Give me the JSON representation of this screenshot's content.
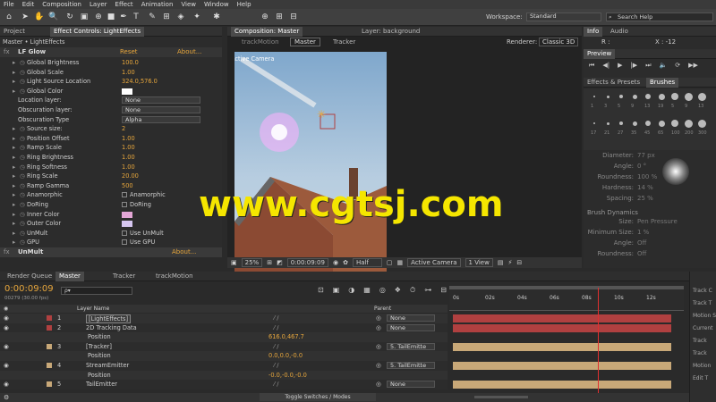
{
  "menu": [
    "File",
    "Edit",
    "Composition",
    "Layer",
    "Effect",
    "Animation",
    "View",
    "Window",
    "Help"
  ],
  "workspace": {
    "label": "Workspace:",
    "value": "Standard",
    "search_placeholder": "Search Help"
  },
  "left_tabs": [
    "Project",
    "Effect Controls: LightEffects"
  ],
  "effect_controls": {
    "breadcrumb": "Master • LightEffects",
    "effect_name": "LF Glow",
    "reset": "Reset",
    "about": "About...",
    "params": [
      {
        "name": "Global Brightness",
        "value": "100.0"
      },
      {
        "name": "Global Scale",
        "value": "1.00"
      },
      {
        "name": "Light Source Location",
        "value": "324.0,576.0"
      },
      {
        "name": "Global Color",
        "value": ""
      },
      {
        "name": "Location layer:",
        "value": "None"
      },
      {
        "name": "Obscuration layer:",
        "value": "None"
      },
      {
        "name": "Obscuration Type",
        "value": "Alpha"
      },
      {
        "name": "Source size:",
        "value": "2"
      },
      {
        "name": "Position Offset",
        "value": "1.00"
      },
      {
        "name": "Ramp Scale",
        "value": "1.00"
      },
      {
        "name": "Ring Brightness",
        "value": "1.00"
      },
      {
        "name": "Ring Softness",
        "value": "1.00"
      },
      {
        "name": "Ring Scale",
        "value": "20.00"
      },
      {
        "name": "Ramp Gamma",
        "value": "500"
      },
      {
        "name": "Anamorphic",
        "value": "Anamorphic"
      },
      {
        "name": "DoRing",
        "value": "DoRing"
      },
      {
        "name": "Inner Color",
        "value": ""
      },
      {
        "name": "Outer Color",
        "value": ""
      },
      {
        "name": "UnMult",
        "value": "Use UnMult"
      },
      {
        "name": "GPU",
        "value": "Use GPU"
      }
    ],
    "unmult": "UnMult",
    "unmult_about": "About..."
  },
  "comp_tabs": [
    "Composition: Master",
    "Layer: background"
  ],
  "comp_subtabs": [
    "trackMotion",
    "Master",
    "Tracker"
  ],
  "renderer": "Renderer:",
  "renderer_value": "Classic 3D",
  "active_camera": "Active Camera",
  "comp_footer": {
    "zoom": "25%",
    "time": "0:00:09:09",
    "quality": "Half",
    "camera": "Active Camera",
    "views": "1 View"
  },
  "right": {
    "info_tabs": [
      "Info",
      "Audio"
    ],
    "r_label": "R :",
    "x_label": "X : -12",
    "preview": "Preview",
    "fx_tabs": [
      "Effects & Presets",
      "Brushes"
    ],
    "brush_sizes": [
      "1",
      "3",
      "5",
      "9",
      "13",
      "19",
      "5",
      "9",
      "13",
      "17",
      "21",
      "27",
      "35",
      "45",
      "65",
      "100",
      "200",
      "300"
    ],
    "props": [
      {
        "label": "Diameter:",
        "value": "77 px"
      },
      {
        "label": "Angle:",
        "value": "0 °"
      },
      {
        "label": "Roundness:",
        "value": "100 %"
      },
      {
        "label": "Hardness:",
        "value": "14 %"
      },
      {
        "label": "Spacing:",
        "value": "25 %"
      }
    ],
    "dynamics": "Brush Dynamics",
    "dyn_props": [
      {
        "label": "Size:",
        "value": "Pen Pressure"
      },
      {
        "label": "Minimum Size:",
        "value": "1 %"
      },
      {
        "label": "Angle:",
        "value": "Off"
      },
      {
        "label": "Roundness:",
        "value": "Off"
      }
    ]
  },
  "timeline": {
    "tabs": [
      "Render Queue",
      "Master",
      "Tracker",
      "trackMotion"
    ],
    "time": "0:00:09:09",
    "frames": "00279 (30.00 fps)",
    "search_placeholder": "ρ▾",
    "col_layer_name": "Layer Name",
    "col_parent": "Parent",
    "ruler": [
      "0s",
      "02s",
      "04s",
      "06s",
      "08s",
      "10s",
      "12s"
    ],
    "rows": [
      {
        "num": "1",
        "name": "[LightEffects]",
        "parent": "None",
        "color": "#b04040"
      },
      {
        "num": "2",
        "name": "2D Tracking Data",
        "parent": "None",
        "color": "#b04040"
      },
      {
        "num": "",
        "name": "Position",
        "value": "616.0,467.7",
        "parent": ""
      },
      {
        "num": "3",
        "name": "[Tracker]",
        "parent": "5. TailEmitte",
        "color": "#c8a878"
      },
      {
        "num": "",
        "name": "Position",
        "value": "0.0,0.0,-0.0",
        "parent": ""
      },
      {
        "num": "4",
        "name": "StreamEmitter",
        "parent": "5. TailEmitte",
        "color": "#c8a878"
      },
      {
        "num": "",
        "name": "Position",
        "value": "-0.0,-0.0,-0.0",
        "parent": ""
      },
      {
        "num": "5",
        "name": "TailEmitter",
        "parent": "None",
        "color": "#c8a878"
      }
    ],
    "toggle": "Toggle Switches / Modes"
  },
  "far_right": {
    "labels": [
      "Track C",
      "Track T",
      "Motion S",
      "Current",
      "Track",
      "Track",
      "Motion",
      "Edit T"
    ]
  },
  "watermark": "www.cgtsj.com",
  "colors": {
    "accent": "#e8a73c",
    "red_bar": "#b04040",
    "tan_bar": "#c8a878",
    "watermark": "#f5e600"
  }
}
